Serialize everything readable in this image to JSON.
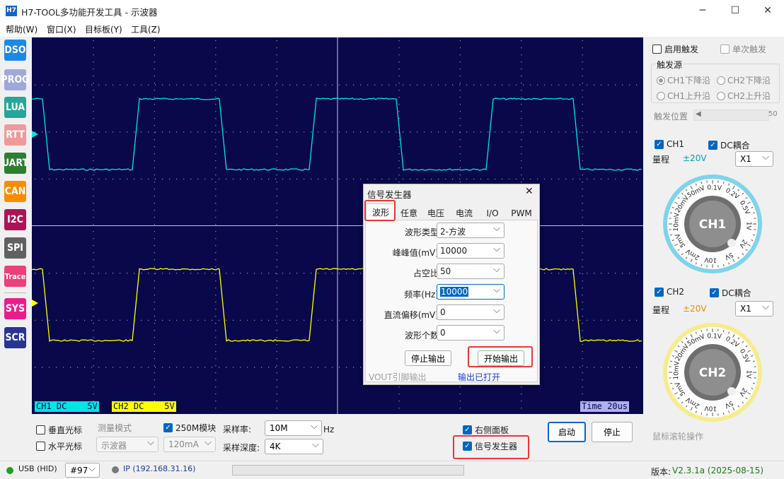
{
  "app": {
    "logo": "H7",
    "title": "H7-TOOL多功能开发工具 - 示波器"
  },
  "menu": [
    "帮助(W)",
    "窗口(X)",
    "目标板(Y)",
    "工具(Z)"
  ],
  "sidebar": [
    {
      "label": "DSO",
      "color": "#1e88e5"
    },
    {
      "label": "PROG",
      "color": "#9fa8da"
    },
    {
      "label": "LUA",
      "color": "#26a69a"
    },
    {
      "label": "RTT",
      "color": "#ef9a9a"
    },
    {
      "label": "UART",
      "color": "#2e7d32"
    },
    {
      "label": "CAN",
      "color": "#fb8c00"
    },
    {
      "label": "I2C",
      "color": "#ad1457"
    },
    {
      "label": "SPI",
      "color": "#616161"
    },
    {
      "label": "Trace",
      "color": "#ec407a"
    },
    {
      "label": "SYS",
      "color": "#e91e8c"
    },
    {
      "label": "SCR",
      "color": "#283593"
    }
  ],
  "scope": {
    "ch1_label": "CH1 DC    5V",
    "ch2_label": "CH2 DC    5V",
    "time_label": "Time 20us",
    "ch1_color": "#00e5e5",
    "ch2_color": "#ffff00"
  },
  "trigger": {
    "enable": "启用触发",
    "single": "单次触发",
    "source_title": "触发源",
    "options": [
      "CH1下降沿",
      "CH2下降沿",
      "CH1上升沿",
      "CH2上升沿"
    ],
    "position_label": "触发位置",
    "position_value": "50"
  },
  "ch1": {
    "name": "CH1",
    "coupling": "DC耦合",
    "range_label": "量程",
    "range_value": "±20V",
    "probe": "X1",
    "knob": "CH1",
    "dial": [
      "0.1V",
      "0.2V",
      "0.5V",
      "1V",
      "2V",
      "5V",
      "10V",
      "2mV",
      "5mV",
      "10mV",
      "20mV",
      "50mV"
    ]
  },
  "ch2": {
    "name": "CH2",
    "coupling": "DC耦合",
    "range_label": "量程",
    "range_value": "±20V",
    "probe": "X1",
    "knob": "CH2",
    "dial": [
      "0.1V",
      "0.2V",
      "0.5V",
      "1V",
      "2V",
      "5V",
      "10V",
      "2mV",
      "5mV",
      "10mV",
      "20mV",
      "50mV"
    ]
  },
  "mouse_hint": "鼠标滚轮操作",
  "bottom": {
    "vcursor": "垂直光标",
    "hcursor": "水平光标",
    "measure_mode": "测量模式",
    "measure_value": "示波器",
    "module_250m": "250M模块",
    "current_value": "120mA",
    "sample_rate_label": "采样率:",
    "sample_rate_value": "10M",
    "hz": "Hz",
    "depth_label": "采样深度:",
    "depth_value": "4K",
    "right_panel": "右侧面板",
    "signal_gen": "信号发生器",
    "start": "启动",
    "stop": "停止"
  },
  "status": {
    "usb": "USB (HID)",
    "device": "#97",
    "ip": "IP (192.168.31.16)",
    "version_label": "版本:",
    "version_value": "V2.3.1a (2025-08-15)"
  },
  "dialog": {
    "title": "信号发生器",
    "tabs": [
      "波形",
      "任意",
      "电压",
      "电流",
      "I/O",
      "PWM"
    ],
    "fields": [
      {
        "label": "波形类型:",
        "value": "2-方波"
      },
      {
        "label": "峰峰值(mV):",
        "value": "10000"
      },
      {
        "label": "占空比:",
        "value": "50"
      },
      {
        "label": "频率(Hz):",
        "value": "10000"
      },
      {
        "label": "直流偏移(mV):",
        "value": "0"
      },
      {
        "label": "波形个数:",
        "value": "0"
      }
    ],
    "stop_output": "停止输出",
    "start_output": "开始输出",
    "vout_note": "VOUT引脚输出",
    "output_status": "输出已打开"
  }
}
